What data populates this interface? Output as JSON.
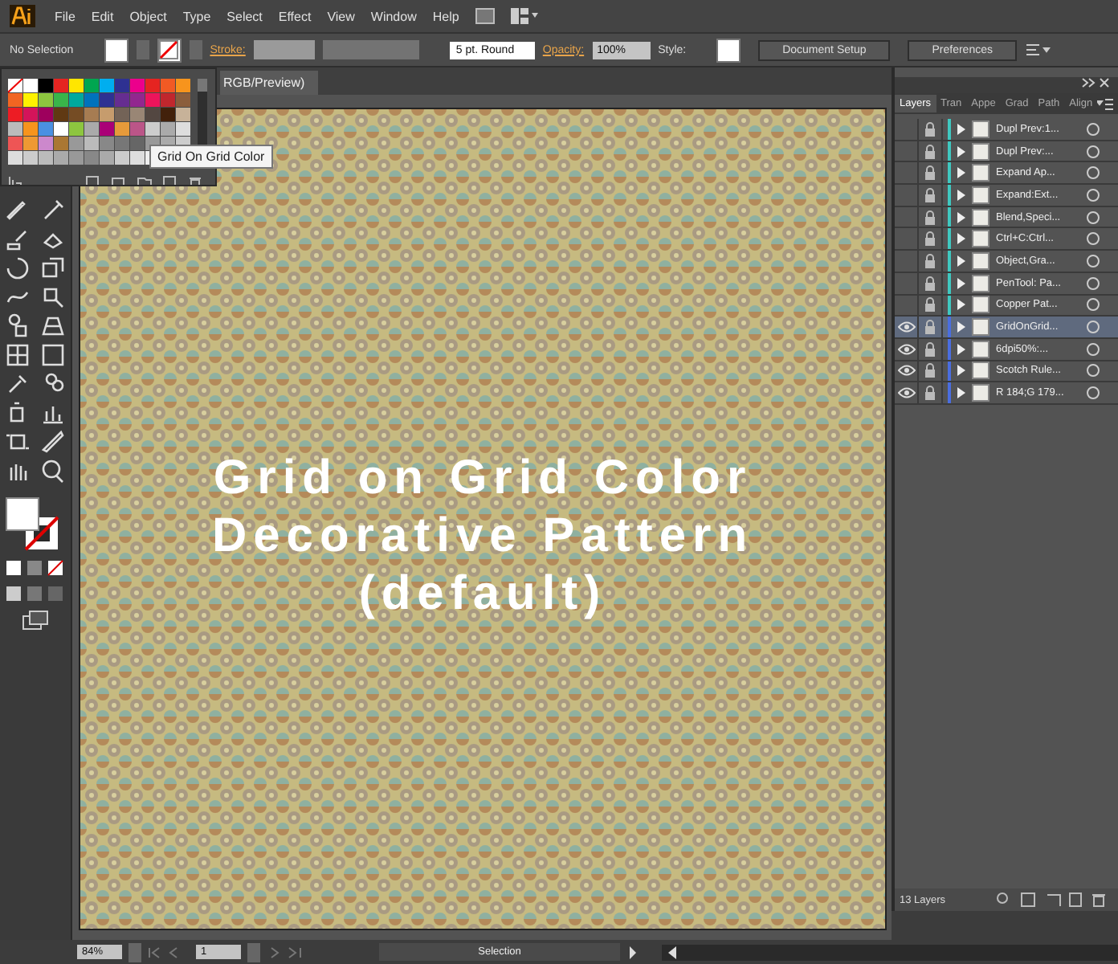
{
  "menu": [
    "File",
    "Edit",
    "Object",
    "Type",
    "Select",
    "Effect",
    "View",
    "Window",
    "Help"
  ],
  "control_bar": {
    "selection": "No Selection",
    "stroke_label": "Stroke:",
    "brush": "5 pt. Round",
    "opacity_label": "Opacity:",
    "opacity": "100%",
    "style_label": "Style:",
    "buttons": [
      "Document Setup",
      "Preferences"
    ]
  },
  "document_tab": {
    "title": "RGB/Preview)"
  },
  "swatches": {
    "tooltip": "Grid On Grid Color"
  },
  "artwork": {
    "kind": "picture",
    "caption_lines": [
      "Grid on Grid Color",
      "Decorative Pattern",
      "(default)"
    ]
  },
  "layers_panel": {
    "tabs": [
      {
        "label": "Layers",
        "selected": true
      },
      {
        "label": "Tran",
        "selected": false
      },
      {
        "label": "Appe",
        "selected": false
      },
      {
        "label": "Grad",
        "selected": false
      },
      {
        "label": "Path",
        "selected": false
      },
      {
        "label": "Align",
        "selected": false
      }
    ],
    "layers": [
      {
        "name": "Dupl Prev:1...",
        "visible": false,
        "selected": false,
        "color": "#3fc8c0"
      },
      {
        "name": "Dupl Prev:...",
        "visible": false,
        "selected": false,
        "color": "#3fc8c0"
      },
      {
        "name": "Expand Ap...",
        "visible": false,
        "selected": false,
        "color": "#3fc8c0"
      },
      {
        "name": "Expand:Ext...",
        "visible": false,
        "selected": false,
        "color": "#3fc8c0"
      },
      {
        "name": "Blend,Speci...",
        "visible": false,
        "selected": false,
        "color": "#3fc8c0"
      },
      {
        "name": "Ctrl+C:Ctrl...",
        "visible": false,
        "selected": false,
        "color": "#3fc8c0"
      },
      {
        "name": "Object,Gra...",
        "visible": false,
        "selected": false,
        "color": "#3fc8c0"
      },
      {
        "name": "PenTool: Pa...",
        "visible": false,
        "selected": false,
        "color": "#3fc8c0"
      },
      {
        "name": "Copper Pat...",
        "visible": false,
        "selected": false,
        "color": "#3fc8c0"
      },
      {
        "name": "GridOnGrid...",
        "visible": true,
        "selected": true,
        "color": "#4a6ee0"
      },
      {
        "name": "6dpi50%:...",
        "visible": true,
        "selected": false,
        "color": "#4a6ee0"
      },
      {
        "name": "Scotch Rule...",
        "visible": true,
        "selected": false,
        "color": "#4a6ee0"
      },
      {
        "name": "R 184;G 179...",
        "visible": true,
        "selected": false,
        "color": "#4a6ee0"
      }
    ],
    "count": "13 Layers"
  },
  "status_bar": {
    "zoom": "84%",
    "page": "1",
    "tool": "Selection"
  }
}
